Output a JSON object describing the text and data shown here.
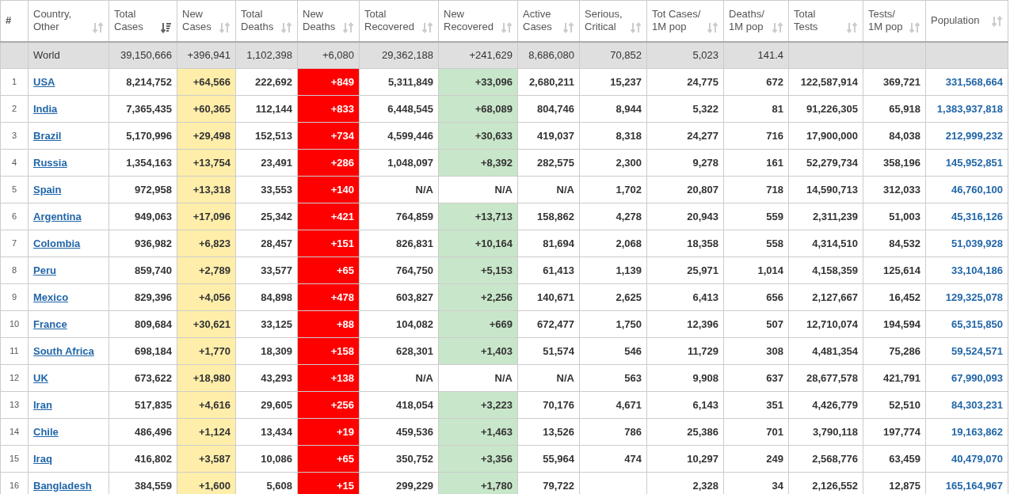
{
  "table": {
    "columns": [
      {
        "label_lines": [
          "#"
        ]
      },
      {
        "label_lines": [
          "Country,",
          "Other"
        ],
        "sorted": false
      },
      {
        "label_lines": [
          "Total",
          "Cases"
        ],
        "sorted": true
      },
      {
        "label_lines": [
          "New",
          "Cases"
        ],
        "sorted": false
      },
      {
        "label_lines": [
          "Total",
          "Deaths"
        ],
        "sorted": false
      },
      {
        "label_lines": [
          "New",
          "Deaths"
        ],
        "sorted": false
      },
      {
        "label_lines": [
          "Total",
          "Recovered"
        ],
        "sorted": false
      },
      {
        "label_lines": [
          "New",
          "Recovered"
        ],
        "sorted": false
      },
      {
        "label_lines": [
          "Active",
          "Cases"
        ],
        "sorted": false
      },
      {
        "label_lines": [
          "Serious,",
          "Critical"
        ],
        "sorted": false
      },
      {
        "label_lines": [
          "Tot Cases/",
          "1M pop"
        ],
        "sorted": false
      },
      {
        "label_lines": [
          "Deaths/",
          "1M pop"
        ],
        "sorted": false
      },
      {
        "label_lines": [
          "Total",
          "Tests"
        ],
        "sorted": false
      },
      {
        "label_lines": [
          "Tests/",
          "1M pop"
        ],
        "sorted": false
      },
      {
        "label_lines": [
          "Population"
        ],
        "sorted": false
      }
    ],
    "rows": [
      {
        "kind": "total",
        "cells": [
          "",
          "World",
          "39,150,666",
          "+396,941",
          "1,102,398",
          "+6,080",
          "29,362,188",
          "+241,629",
          "8,686,080",
          "70,852",
          "5,023",
          "141.4",
          "",
          "",
          ""
        ]
      },
      {
        "kind": "country",
        "new_recovered_marked": true,
        "cells": [
          "1",
          "USA",
          "8,214,752",
          "+64,566",
          "222,692",
          "+849",
          "5,311,849",
          "+33,096",
          "2,680,211",
          "15,237",
          "24,775",
          "672",
          "122,587,914",
          "369,721",
          "331,568,664"
        ]
      },
      {
        "kind": "country",
        "new_recovered_marked": true,
        "cells": [
          "2",
          "India",
          "7,365,435",
          "+60,365",
          "112,144",
          "+833",
          "6,448,545",
          "+68,089",
          "804,746",
          "8,944",
          "5,322",
          "81",
          "91,226,305",
          "65,918",
          "1,383,937,818"
        ]
      },
      {
        "kind": "country",
        "new_recovered_marked": true,
        "cells": [
          "3",
          "Brazil",
          "5,170,996",
          "+29,498",
          "152,513",
          "+734",
          "4,599,446",
          "+30,633",
          "419,037",
          "8,318",
          "24,277",
          "716",
          "17,900,000",
          "84,038",
          "212,999,232"
        ]
      },
      {
        "kind": "country",
        "new_recovered_marked": true,
        "cells": [
          "4",
          "Russia",
          "1,354,163",
          "+13,754",
          "23,491",
          "+286",
          "1,048,097",
          "+8,392",
          "282,575",
          "2,300",
          "9,278",
          "161",
          "52,279,734",
          "358,196",
          "145,952,851"
        ]
      },
      {
        "kind": "country",
        "new_recovered_marked": false,
        "cells": [
          "5",
          "Spain",
          "972,958",
          "+13,318",
          "33,553",
          "+140",
          "N/A",
          "N/A",
          "N/A",
          "1,702",
          "20,807",
          "718",
          "14,590,713",
          "312,033",
          "46,760,100"
        ]
      },
      {
        "kind": "country",
        "new_recovered_marked": true,
        "cells": [
          "6",
          "Argentina",
          "949,063",
          "+17,096",
          "25,342",
          "+421",
          "764,859",
          "+13,713",
          "158,862",
          "4,278",
          "20,943",
          "559",
          "2,311,239",
          "51,003",
          "45,316,126"
        ]
      },
      {
        "kind": "country",
        "new_recovered_marked": true,
        "cells": [
          "7",
          "Colombia",
          "936,982",
          "+6,823",
          "28,457",
          "+151",
          "826,831",
          "+10,164",
          "81,694",
          "2,068",
          "18,358",
          "558",
          "4,314,510",
          "84,532",
          "51,039,928"
        ]
      },
      {
        "kind": "country",
        "new_recovered_marked": true,
        "cells": [
          "8",
          "Peru",
          "859,740",
          "+2,789",
          "33,577",
          "+65",
          "764,750",
          "+5,153",
          "61,413",
          "1,139",
          "25,971",
          "1,014",
          "4,158,359",
          "125,614",
          "33,104,186"
        ]
      },
      {
        "kind": "country",
        "new_recovered_marked": true,
        "cells": [
          "9",
          "Mexico",
          "829,396",
          "+4,056",
          "84,898",
          "+478",
          "603,827",
          "+2,256",
          "140,671",
          "2,625",
          "6,413",
          "656",
          "2,127,667",
          "16,452",
          "129,325,078"
        ]
      },
      {
        "kind": "country",
        "new_recovered_marked": true,
        "cells": [
          "10",
          "France",
          "809,684",
          "+30,621",
          "33,125",
          "+88",
          "104,082",
          "+669",
          "672,477",
          "1,750",
          "12,396",
          "507",
          "12,710,074",
          "194,594",
          "65,315,850"
        ]
      },
      {
        "kind": "country",
        "new_recovered_marked": true,
        "cells": [
          "11",
          "South Africa",
          "698,184",
          "+1,770",
          "18,309",
          "+158",
          "628,301",
          "+1,403",
          "51,574",
          "546",
          "11,729",
          "308",
          "4,481,354",
          "75,286",
          "59,524,571"
        ]
      },
      {
        "kind": "country",
        "new_recovered_marked": false,
        "cells": [
          "12",
          "UK",
          "673,622",
          "+18,980",
          "43,293",
          "+138",
          "N/A",
          "N/A",
          "N/A",
          "563",
          "9,908",
          "637",
          "28,677,578",
          "421,791",
          "67,990,093"
        ]
      },
      {
        "kind": "country",
        "new_recovered_marked": true,
        "cells": [
          "13",
          "Iran",
          "517,835",
          "+4,616",
          "29,605",
          "+256",
          "418,054",
          "+3,223",
          "70,176",
          "4,671",
          "6,143",
          "351",
          "4,426,779",
          "52,510",
          "84,303,231"
        ]
      },
      {
        "kind": "country",
        "new_recovered_marked": true,
        "cells": [
          "14",
          "Chile",
          "486,496",
          "+1,124",
          "13,434",
          "+19",
          "459,536",
          "+1,463",
          "13,526",
          "786",
          "25,386",
          "701",
          "3,790,118",
          "197,774",
          "19,163,862"
        ]
      },
      {
        "kind": "country",
        "new_recovered_marked": true,
        "cells": [
          "15",
          "Iraq",
          "416,802",
          "+3,587",
          "10,086",
          "+65",
          "350,752",
          "+3,356",
          "55,964",
          "474",
          "10,297",
          "249",
          "2,568,776",
          "63,459",
          "40,479,070"
        ]
      },
      {
        "kind": "country",
        "new_recovered_marked": true,
        "cells": [
          "16",
          "Bangladesh",
          "384,559",
          "+1,600",
          "5,608",
          "+15",
          "299,229",
          "+1,780",
          "79,722",
          "",
          "2,328",
          "34",
          "2,126,552",
          "12,875",
          "165,164,967"
        ]
      }
    ]
  }
}
